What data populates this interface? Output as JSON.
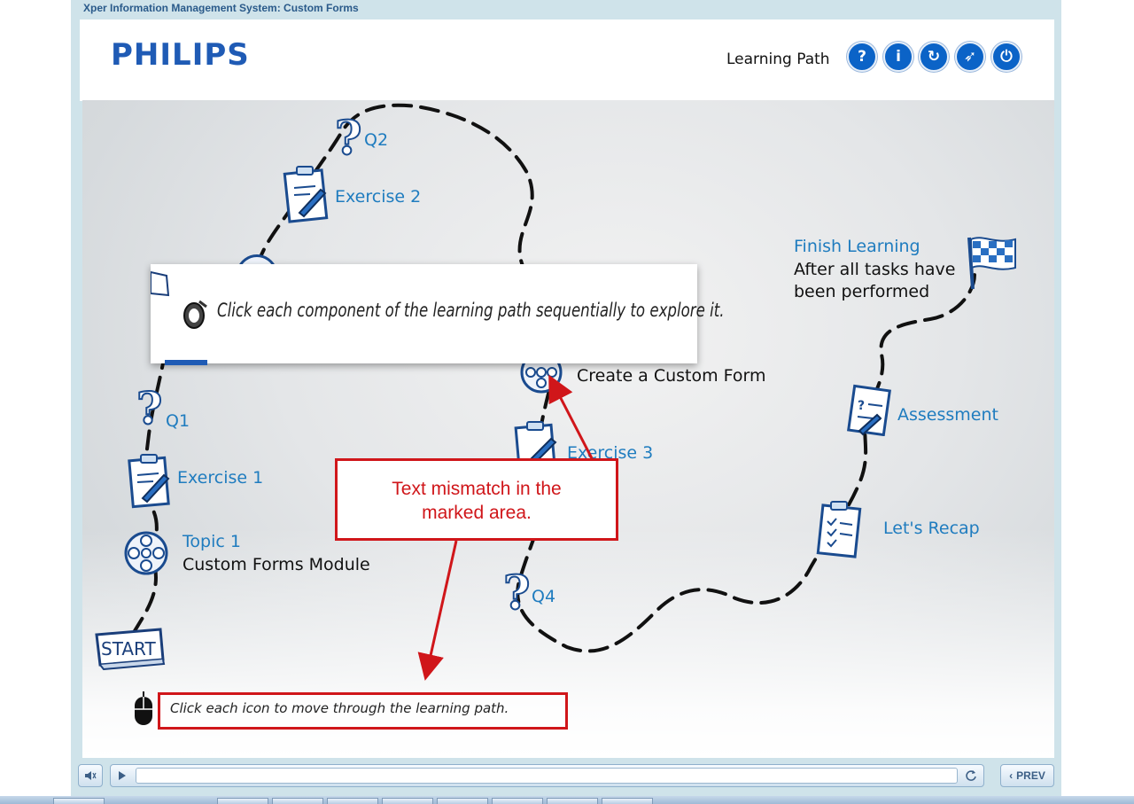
{
  "window": {
    "title": "Xper Information Management System: Custom Forms"
  },
  "header": {
    "logo": "PHILIPS",
    "section_label": "Learning Path",
    "buttons": [
      {
        "name": "help",
        "glyph": "?"
      },
      {
        "name": "info",
        "glyph": "i"
      },
      {
        "name": "refresh",
        "glyph": "↻"
      },
      {
        "name": "compass",
        "glyph": "➶"
      },
      {
        "name": "power",
        "glyph": "⏻"
      }
    ]
  },
  "path": {
    "start": "START",
    "q1": "Q1",
    "q2": "Q2",
    "q4": "Q4",
    "exercise1": "Exercise 1",
    "exercise2": "Exercise 2",
    "exercise3": "Exercise 3",
    "topic1_title": "Topic 1",
    "topic1_sub": "Custom Forms Module",
    "create_form": "Create a Custom Form",
    "assessment": "Assessment",
    "recap": "Let's Recap",
    "finish_title": "Finish Learning",
    "finish_line1": "After all tasks have",
    "finish_line2": "been performed"
  },
  "popup": {
    "text": "Click each component of the learning path sequentially to explore it."
  },
  "annotation": {
    "line1": "Text mismatch in the",
    "line2": "marked area."
  },
  "hint": {
    "text": "Click each icon to move through the learning path."
  },
  "controls": {
    "prev_label": "PREV"
  },
  "colors": {
    "label_blue": "#1f7cbf",
    "brand_blue": "#1f5bb5",
    "annotation_red": "#d0161a"
  }
}
